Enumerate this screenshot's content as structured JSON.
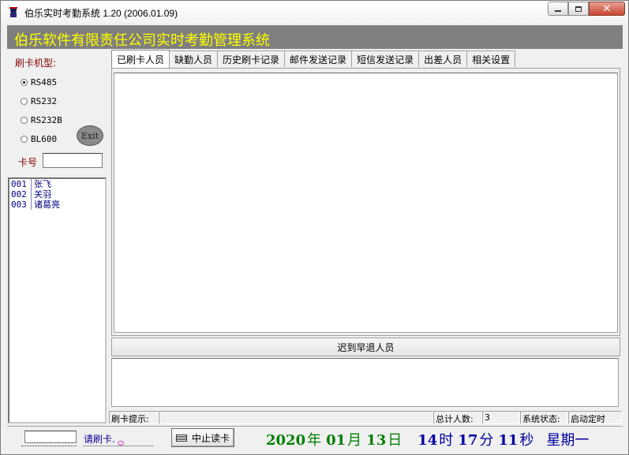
{
  "window": {
    "title": "伯乐实时考勤系统 1.20 (2006.01.09)",
    "controls": {
      "minimize": "▭",
      "maximize": "□",
      "close": "✕"
    }
  },
  "banner": {
    "text": "伯乐软件有限责任公司实时考勤管理系统"
  },
  "left": {
    "machine_label": "刷卡机型:",
    "options": [
      "RS485",
      "RS232",
      "RS232B",
      "BL600"
    ],
    "selected": "RS485",
    "exit_label": "Exit",
    "card_label": "卡号",
    "card_value": "",
    "employees": [
      {
        "id": "001",
        "name": "张飞"
      },
      {
        "id": "002",
        "name": "关羽"
      },
      {
        "id": "003",
        "name": "诸葛亮"
      }
    ]
  },
  "tabs": [
    "已刷卡人员",
    "缺勤人员",
    "历史刷卡记录",
    "邮件发送记录",
    "短信发送记录",
    "出差人员",
    "相关设置"
  ],
  "active_tab": "已刷卡人员",
  "late_section": {
    "label": "迟到早退人员"
  },
  "status": {
    "hint_label": "刷卡提示:",
    "hint_value": "",
    "total_label": "总计人数:",
    "total_value": "3",
    "sys_label": "系统状态:",
    "sys_value": "启动定时"
  },
  "bottom": {
    "prompt": "请刷卡.",
    "stop_button": "中止读卡",
    "date": {
      "year": "2020",
      "year_unit": "年",
      "month": "01",
      "month_unit": "月",
      "day": "13",
      "day_unit": "日"
    },
    "time": {
      "hour": "14",
      "hour_unit": "时",
      "minute": "17",
      "minute_unit": "分",
      "second": "11",
      "second_unit": "秒"
    },
    "weekday": "星期一"
  },
  "colors": {
    "banner_bg": "#7f7f7f",
    "banner_text": "#ffff00",
    "label_maroon": "#800000",
    "list_text": "#000080",
    "date_green": "#008000",
    "time_blue": "#0000a0"
  }
}
